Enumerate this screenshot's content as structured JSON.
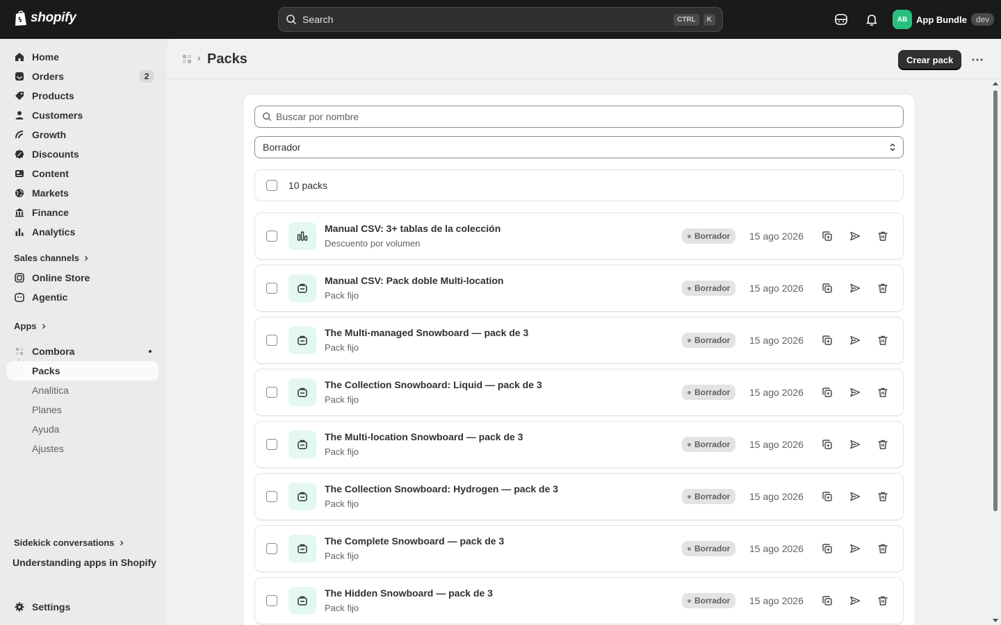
{
  "topbar": {
    "brand": "shopify",
    "search_label": "Search",
    "shortcut_ctrl": "CTRL",
    "shortcut_k": "K",
    "user_initials": "AB",
    "user_name": "App Bundle",
    "user_badge": "dev"
  },
  "sidebar": {
    "nav": [
      {
        "label": "Home",
        "icon": "home-icon"
      },
      {
        "label": "Orders",
        "icon": "orders-icon",
        "badge": "2"
      },
      {
        "label": "Products",
        "icon": "tag-icon"
      },
      {
        "label": "Customers",
        "icon": "person-icon"
      },
      {
        "label": "Growth",
        "icon": "growth-icon"
      },
      {
        "label": "Discounts",
        "icon": "discount-icon"
      },
      {
        "label": "Content",
        "icon": "content-icon"
      },
      {
        "label": "Markets",
        "icon": "globe-icon"
      },
      {
        "label": "Finance",
        "icon": "bank-icon"
      },
      {
        "label": "Analytics",
        "icon": "bar-chart-icon"
      }
    ],
    "sales_channels_label": "Sales channels",
    "channels": [
      {
        "label": "Online Store",
        "icon": "store-icon"
      },
      {
        "label": "Agentic",
        "icon": "agent-icon"
      }
    ],
    "apps_label": "Apps",
    "app_name": "Combora",
    "app_subitems": [
      "Packs",
      "Analitica",
      "Planes",
      "Ayuda",
      "Ajustes"
    ],
    "sidekick_label": "Sidekick conversations",
    "sidekick_item": "Understanding apps in Shopify",
    "settings_label": "Settings"
  },
  "page": {
    "title": "Packs",
    "primary_action": "Crear pack"
  },
  "filters": {
    "search_placeholder": "Buscar por nombre",
    "status_selected": "Borrador",
    "count_label": "10 packs"
  },
  "packs": [
    {
      "title": "Manual CSV: 3+ tablas de la colección",
      "type": "Descuento por volumen",
      "icon": "volume-chart-icon",
      "status": "Borrador",
      "date": "15 ago 2026"
    },
    {
      "title": "Manual CSV: Pack doble Multi-location",
      "type": "Pack fijo",
      "icon": "bundle-box-icon",
      "status": "Borrador",
      "date": "15 ago 2026"
    },
    {
      "title": "The Multi-managed Snowboard — pack de 3",
      "type": "Pack fijo",
      "icon": "bundle-box-icon",
      "status": "Borrador",
      "date": "15 ago 2026"
    },
    {
      "title": "The Collection Snowboard: Liquid — pack de 3",
      "type": "Pack fijo",
      "icon": "bundle-box-icon",
      "status": "Borrador",
      "date": "15 ago 2026"
    },
    {
      "title": "The Multi-location Snowboard — pack de 3",
      "type": "Pack fijo",
      "icon": "bundle-box-icon",
      "status": "Borrador",
      "date": "15 ago 2026"
    },
    {
      "title": "The Collection Snowboard: Hydrogen — pack de 3",
      "type": "Pack fijo",
      "icon": "bundle-box-icon",
      "status": "Borrador",
      "date": "15 ago 2026"
    },
    {
      "title": "The Complete Snowboard — pack de 3",
      "type": "Pack fijo",
      "icon": "bundle-box-icon",
      "status": "Borrador",
      "date": "15 ago 2026"
    },
    {
      "title": "The Hidden Snowboard — pack de 3",
      "type": "Pack fijo",
      "icon": "bundle-box-icon",
      "status": "Borrador",
      "date": "15 ago 2026"
    }
  ],
  "colors": {
    "topbar": "#1a1a1a",
    "accent_green": "#27c07d",
    "thumb_bg": "#e3f8ef",
    "primary_button": "#303030"
  }
}
